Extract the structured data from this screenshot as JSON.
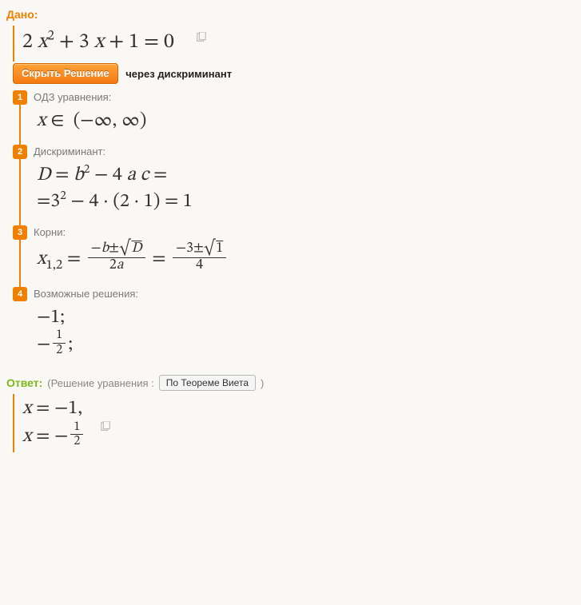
{
  "given": {
    "heading": "Дано:",
    "equation_html": "2 <i>x</i><sup>2</sup> + 3 <i>x</i> + 1 = 0"
  },
  "toggle": {
    "button": "Скрыть Решение",
    "method": "через дискриминант"
  },
  "steps": [
    {
      "num": "1",
      "label": "ОДЗ уравнения:",
      "lines_html": [
        "<i>x</i> ∈&nbsp;&nbsp;(−∞, ∞)"
      ]
    },
    {
      "num": "2",
      "label": "Дискриминант:",
      "lines_html": [
        "<i>D</i> = <i>b</i><sup>2</sup> − 4 <i>a c</i> =",
        "=3<sup>2</sup> − 4 · (2 · 1) = 1"
      ]
    },
    {
      "num": "3",
      "label": "Корни:",
      "lines_html": [
        "<i>x</i><sub>1,2</sub> = <span class=\"frac\"><span class=\"num\">−<i>b</i>±√<span class=\"sqrt\"><i>D</i></span></span><span class=\"den\">2<i>a</i></span></span> = <span class=\"frac\"><span class=\"num\">−3±√<span class=\"sqrt\">1</span></span><span class=\"den\">4</span></span>"
      ]
    },
    {
      "num": "4",
      "label": "Возможные решения:",
      "lines_html": [
        "−1;",
        "−<span class=\"frac sfrac\"><span class=\"num\">1</span><span class=\"den\">2</span></span>;"
      ]
    }
  ],
  "answer": {
    "heading": "Ответ:",
    "paren_prefix": "(Решение уравнения :",
    "vieta_button": "По Теореме Виета",
    "paren_suffix": ")",
    "lines_html": [
      "<i>x</i> = −1,",
      "<i>x</i> = −<span class=\"frac sfrac\"><span class=\"num\">1</span><span class=\"den\">2</span></span>"
    ]
  },
  "icons": {
    "copy": "copy-icon"
  }
}
